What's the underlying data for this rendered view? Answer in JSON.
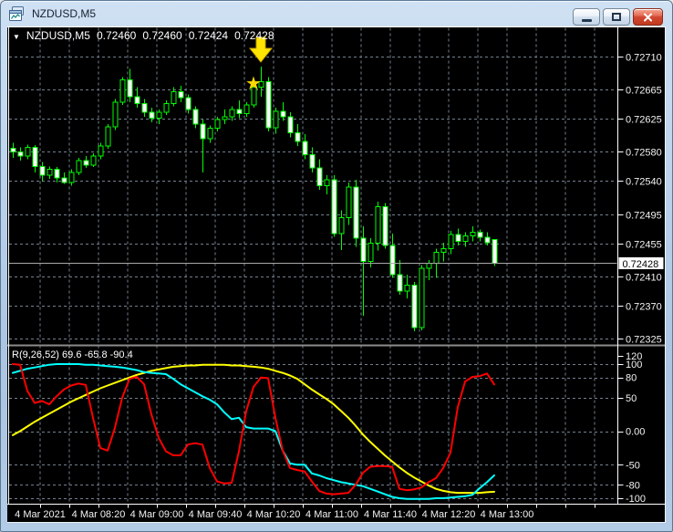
{
  "window": {
    "title": "NZDUSD,M5",
    "minimize_label": "minimize",
    "restore_label": "restore",
    "close_label": "close"
  },
  "header": {
    "dropdown_icon": "▼",
    "symbol": "NZDUSD,M5",
    "open": "0.72460",
    "high": "0.72460",
    "low": "0.72424",
    "close": "0.72428"
  },
  "colors": {
    "background": "#000000",
    "grid": "#73808f",
    "frame": "#ffffff",
    "candle_outline": "#00ff00",
    "bull_fill": "#000000",
    "bear_fill": "#ffffff",
    "bid_line": "#a8a8a8",
    "axis_text": "#f2f2f2",
    "current_price_bg": "#ffffff",
    "current_price_text": "#000000",
    "arrow": "#ffe400",
    "star": "#ffd700",
    "separator": "#8c8c8c"
  },
  "chart_data": {
    "type": "candlestick",
    "symbol": "NZDUSD",
    "timeframe": "M5",
    "title": "NZDUSD,M5",
    "price_axis": {
      "side": "right",
      "max": 0.7271,
      "min": 0.72325,
      "labels": [
        "0.72710",
        "0.72665",
        "0.72625",
        "0.72580",
        "0.72540",
        "0.72495",
        "0.72455",
        "0.72410",
        "0.72370",
        "0.72325"
      ],
      "current_price": "0.72428"
    },
    "time_axis": {
      "labels": [
        "4 Mar 2021",
        "4 Mar 08:20",
        "4 Mar 09:00",
        "4 Mar 09:40",
        "4 Mar 10:20",
        "4 Mar 11:00",
        "4 Mar 11:40",
        "4 Mar 12:20",
        "4 Mar 13:00"
      ]
    },
    "candles_ohlc": [
      [
        0.72585,
        0.72592,
        0.72572,
        0.7258
      ],
      [
        0.7258,
        0.72586,
        0.72568,
        0.72574
      ],
      [
        0.72574,
        0.7259,
        0.7257,
        0.72586
      ],
      [
        0.72586,
        0.72589,
        0.72552,
        0.7256
      ],
      [
        0.7256,
        0.72566,
        0.7254,
        0.72548
      ],
      [
        0.72548,
        0.7256,
        0.72543,
        0.72556
      ],
      [
        0.72556,
        0.72559,
        0.72538,
        0.72544
      ],
      [
        0.72544,
        0.72552,
        0.72536,
        0.72538
      ],
      [
        0.72538,
        0.72556,
        0.72534,
        0.72552
      ],
      [
        0.72552,
        0.72572,
        0.72548,
        0.72568
      ],
      [
        0.72568,
        0.72574,
        0.72558,
        0.72562
      ],
      [
        0.72562,
        0.72578,
        0.72559,
        0.72574
      ],
      [
        0.72574,
        0.72592,
        0.7257,
        0.72588
      ],
      [
        0.72588,
        0.72618,
        0.72584,
        0.72614
      ],
      [
        0.72614,
        0.72652,
        0.7261,
        0.72648
      ],
      [
        0.72648,
        0.72682,
        0.72644,
        0.72678
      ],
      [
        0.72678,
        0.72693,
        0.72648,
        0.72655
      ],
      [
        0.72655,
        0.72668,
        0.7264,
        0.72646
      ],
      [
        0.72646,
        0.72652,
        0.72628,
        0.72634
      ],
      [
        0.72634,
        0.7264,
        0.7262,
        0.72626
      ],
      [
        0.72626,
        0.72638,
        0.72618,
        0.72634
      ],
      [
        0.72634,
        0.7265,
        0.7263,
        0.72646
      ],
      [
        0.72646,
        0.72668,
        0.72642,
        0.72662
      ],
      [
        0.72662,
        0.7267,
        0.72648,
        0.72654
      ],
      [
        0.72654,
        0.72658,
        0.72632,
        0.72638
      ],
      [
        0.72638,
        0.72642,
        0.72612,
        0.72618
      ],
      [
        0.72618,
        0.72624,
        0.72552,
        0.72598
      ],
      [
        0.72598,
        0.72616,
        0.72592,
        0.72612
      ],
      [
        0.72612,
        0.72628,
        0.72608,
        0.72624
      ],
      [
        0.72624,
        0.72638,
        0.72618,
        0.72628
      ],
      [
        0.72628,
        0.72642,
        0.72622,
        0.72638
      ],
      [
        0.72638,
        0.7265,
        0.72626,
        0.72632
      ],
      [
        0.72632,
        0.72648,
        0.72628,
        0.72644
      ],
      [
        0.72644,
        0.72672,
        0.7264,
        0.72668
      ],
      [
        0.72668,
        0.72696,
        0.72655,
        0.72676
      ],
      [
        0.72676,
        0.72682,
        0.72608,
        0.72613
      ],
      [
        0.72613,
        0.7264,
        0.72605,
        0.72635
      ],
      [
        0.72635,
        0.72648,
        0.72622,
        0.72628
      ],
      [
        0.72628,
        0.72634,
        0.726,
        0.72606
      ],
      [
        0.72606,
        0.72618,
        0.72588,
        0.72594
      ],
      [
        0.72594,
        0.72604,
        0.7257,
        0.72576
      ],
      [
        0.72576,
        0.72586,
        0.72552,
        0.72558
      ],
      [
        0.72558,
        0.7257,
        0.72528,
        0.72534
      ],
      [
        0.72534,
        0.72548,
        0.72522,
        0.72542
      ],
      [
        0.72542,
        0.72548,
        0.72464,
        0.72468
      ],
      [
        0.72468,
        0.725,
        0.72446,
        0.7249
      ],
      [
        0.7249,
        0.72538,
        0.7248,
        0.72532
      ],
      [
        0.72532,
        0.72542,
        0.7245,
        0.72462
      ],
      [
        0.72462,
        0.72478,
        0.72356,
        0.7243
      ],
      [
        0.7243,
        0.72462,
        0.72422,
        0.72455
      ],
      [
        0.72455,
        0.72512,
        0.72445,
        0.72505
      ],
      [
        0.72505,
        0.7251,
        0.72448,
        0.72452
      ],
      [
        0.72452,
        0.72468,
        0.72408,
        0.72412
      ],
      [
        0.72412,
        0.72432,
        0.72385,
        0.7239
      ],
      [
        0.7239,
        0.72412,
        0.7238,
        0.72398
      ],
      [
        0.72398,
        0.72402,
        0.72335,
        0.7234
      ],
      [
        0.7234,
        0.72425,
        0.72336,
        0.72421
      ],
      [
        0.72421,
        0.72432,
        0.72405,
        0.72428
      ],
      [
        0.72428,
        0.72448,
        0.72408,
        0.72443
      ],
      [
        0.72443,
        0.72456,
        0.7243,
        0.72448
      ],
      [
        0.72448,
        0.72472,
        0.7244,
        0.72467
      ],
      [
        0.72467,
        0.72475,
        0.72452,
        0.72458
      ],
      [
        0.72458,
        0.7247,
        0.7245,
        0.72465
      ],
      [
        0.72465,
        0.72478,
        0.72458,
        0.7247
      ],
      [
        0.7247,
        0.72474,
        0.72458,
        0.72463
      ],
      [
        0.72463,
        0.7247,
        0.72452,
        0.72456
      ],
      [
        0.7246,
        0.7246,
        0.72424,
        0.72428
      ]
    ],
    "annotations": [
      {
        "type": "down-arrow",
        "candle_index": 34,
        "color": "#ffe400"
      },
      {
        "type": "star",
        "candle_index": 33,
        "price": 0.72674,
        "color": "#ffd700"
      }
    ],
    "indicator_panel": {
      "label": "R(9,26,52) 69.6 -65.8 -90.4",
      "name": "R",
      "parameters": [
        9,
        26,
        52
      ],
      "current_values": [
        69.6,
        -65.8,
        -90.4
      ],
      "scale_labels": [
        "120",
        "100",
        "80",
        "50",
        "0.00",
        "-50",
        "-80",
        "-100"
      ],
      "grid_levels": [
        100,
        80,
        50,
        0,
        -50,
        -80,
        -100
      ],
      "ylim": [
        -108,
        124
      ],
      "series": [
        {
          "name": "slow",
          "color": "#ffff00",
          "values": [
            -6,
            0,
            7,
            14,
            20,
            26,
            32,
            38,
            44,
            49,
            54,
            59,
            64,
            68,
            72,
            76,
            80,
            84,
            87,
            90,
            92,
            94,
            96,
            97,
            98,
            98,
            99,
            99,
            99,
            99,
            98,
            98,
            97,
            96,
            95,
            93,
            90,
            87,
            83,
            78,
            70,
            62,
            55,
            48,
            40,
            30,
            20,
            8,
            -5,
            -16,
            -26,
            -36,
            -45,
            -54,
            -62,
            -69,
            -75,
            -81,
            -86,
            -89,
            -91,
            -92,
            -92,
            -92,
            -92,
            -91,
            -90.4
          ]
        },
        {
          "name": "medium",
          "color": "#00ffff",
          "values": [
            87,
            90,
            93,
            95,
            97,
            99,
            100,
            100,
            100,
            100,
            99,
            99,
            98,
            97,
            96,
            95,
            93,
            91,
            88,
            87,
            86,
            85,
            78,
            70,
            64,
            58,
            52,
            47,
            40,
            28,
            18,
            20,
            6,
            4,
            4,
            4,
            0,
            -29,
            -48,
            -50,
            -50,
            -63,
            -66,
            -70,
            -73,
            -76,
            -78,
            -80,
            -82,
            -86,
            -90,
            -94,
            -98,
            -100,
            -101,
            -101,
            -101,
            -101,
            -100,
            -100,
            -99,
            -98,
            -97,
            -95,
            -85,
            -76,
            -65.8
          ]
        },
        {
          "name": "fast",
          "color": "#ff0000",
          "values": [
            100,
            99,
            60,
            42,
            45,
            40,
            52,
            62,
            68,
            71,
            69,
            20,
            -25,
            -29,
            5,
            50,
            78,
            81,
            70,
            25,
            -10,
            -30,
            -36,
            -36,
            -20,
            -18,
            -20,
            -55,
            -75,
            -78,
            -77,
            -30,
            30,
            66,
            80,
            79,
            20,
            -29,
            -55,
            -58,
            -60,
            -75,
            -89,
            -93,
            -94,
            -93,
            -92,
            -80,
            -62,
            -53,
            -52,
            -52,
            -53,
            -86,
            -88,
            -87,
            -84,
            -76,
            -70,
            -55,
            -32,
            36,
            74,
            81,
            82,
            86,
            69.6
          ]
        }
      ]
    }
  }
}
